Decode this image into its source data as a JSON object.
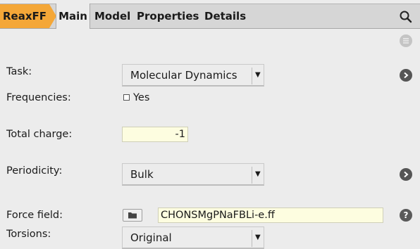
{
  "tabs": {
    "engine": "ReaxFF",
    "main": "Main",
    "model": "Model",
    "properties": "Properties",
    "details": "Details"
  },
  "form": {
    "task": {
      "label": "Task:",
      "value": "Molecular Dynamics"
    },
    "frequencies": {
      "label": "Frequencies:",
      "checkbox_label": "Yes",
      "checked": false
    },
    "total_charge": {
      "label": "Total charge:",
      "value": "-1"
    },
    "periodicity": {
      "label": "Periodicity:",
      "value": "Bulk"
    },
    "force_field": {
      "label": "Force field:",
      "value": "CHONSMgPNaFBLi-e.ff"
    },
    "torsions": {
      "label": "Torsions:",
      "value": "Original"
    }
  },
  "help_symbol": "?",
  "colors": {
    "engine_tab": "#f4a738",
    "input_bg": "#fdfde0",
    "panel_bg": "#ececec",
    "tabbar_bg": "#d6d6d6"
  },
  "icons": [
    "search-icon",
    "menu-icon",
    "chevron-right-icon",
    "folder-icon",
    "help-icon",
    "dropdown-arrow-icon"
  ]
}
